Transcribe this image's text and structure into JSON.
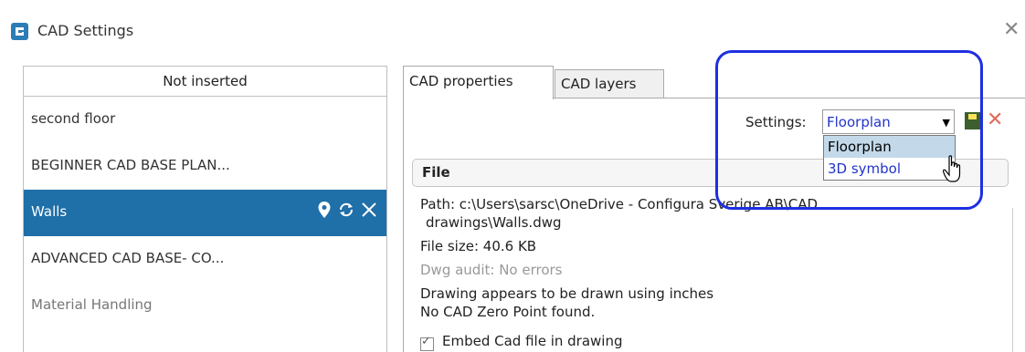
{
  "window": {
    "title": "CAD Settings"
  },
  "left_panel": {
    "header": "Not inserted",
    "items": [
      {
        "label": "second floor"
      },
      {
        "label": "BEGINNER CAD BASE PLAN..."
      },
      {
        "label": "Walls"
      },
      {
        "label": "ADVANCED CAD BASE- CO..."
      },
      {
        "label": "Material Handling"
      }
    ]
  },
  "tabs": [
    {
      "label": "CAD properties"
    },
    {
      "label": "CAD layers"
    }
  ],
  "settings": {
    "label": "Settings:",
    "selected": "Floorplan",
    "options": [
      "Floorplan",
      "3D symbol"
    ]
  },
  "file_section": {
    "title": "File",
    "path_line1": "Path: c:\\Users\\sarsc\\OneDrive - Configura Sverige AB\\CAD",
    "path_line2": "drawings\\Walls.dwg",
    "file_size": "File size: 40.6 KB",
    "dwg_audit": "Dwg audit: No errors",
    "units_note": "Drawing appears to be drawn using inches",
    "zero_point": "No CAD Zero Point found.",
    "embed_label": "Embed Cad file in drawing",
    "embed_checked": true
  },
  "colors": {
    "selected_row": "#1f6fa8",
    "highlight_ring": "#1e2fe0",
    "option_text": "#2233cc"
  },
  "icons": [
    "cad-app-icon",
    "close-icon",
    "location-pin-icon",
    "refresh-icon",
    "remove-icon",
    "save-icon",
    "delete-icon",
    "dropdown-arrow-icon",
    "mouse-cursor-icon"
  ]
}
